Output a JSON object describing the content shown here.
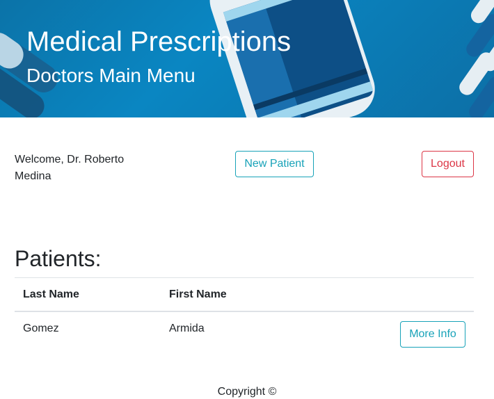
{
  "header": {
    "title": "Medical Prescriptions",
    "subtitle": "Doctors Main Menu"
  },
  "welcome_text": "Welcome, Dr. Roberto Medina",
  "actions": {
    "new_patient_label": "New Patient",
    "logout_label": "Logout"
  },
  "patients": {
    "heading": "Patients:",
    "columns": [
      "Last Name",
      "First Name"
    ],
    "rows": [
      {
        "last_name": "Gomez",
        "first_name": "Armida",
        "action_label": "More Info"
      }
    ]
  },
  "footer": {
    "copyright": "Copyright ©"
  },
  "colors": {
    "info": "#17a2b8",
    "danger": "#dc3545",
    "banner": "#0a86c2"
  }
}
